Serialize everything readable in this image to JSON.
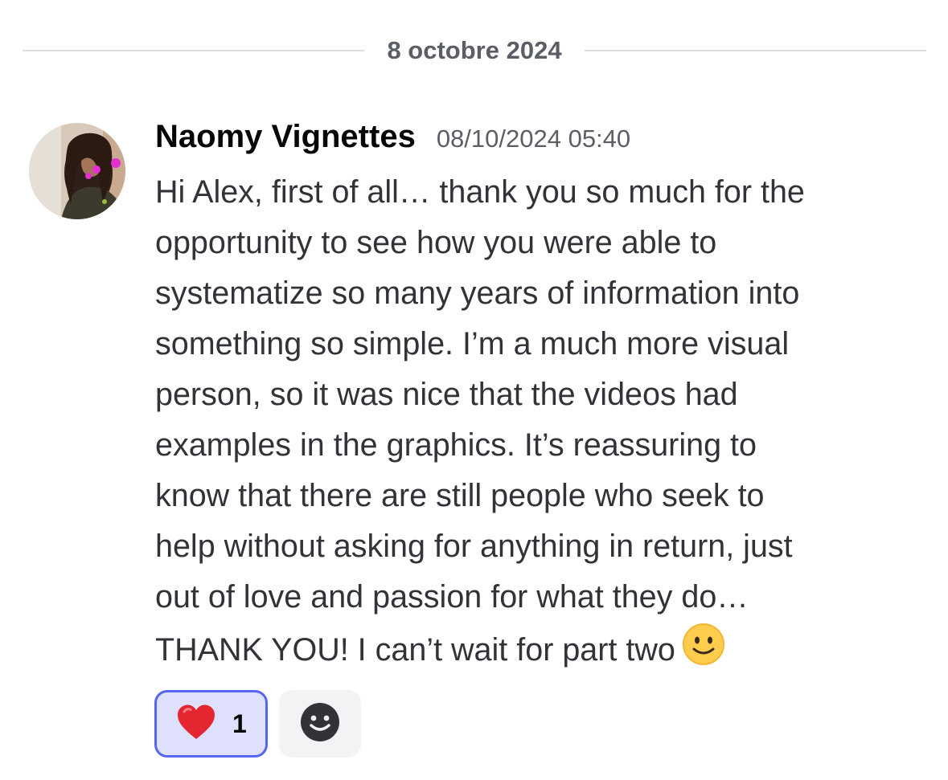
{
  "date_divider": {
    "label": "8 octobre 2024"
  },
  "message": {
    "author": "Naomy Vignettes",
    "timestamp": "08/10/2024 05:40",
    "lines": [
      "Hi Alex, first of all… thank you so much for the",
      "opportunity to see how you were able to",
      "systematize so many years of information into",
      "something so simple. I’m a much more visual",
      "person, so it was nice that the videos had",
      "examples in the graphics. It’s reassuring to",
      "know that there are still people who seek to",
      "help without asking for anything in return, just",
      "out of love and passion for what they do…",
      "THANK YOU! I can’t wait for part two"
    ],
    "trailing_emoji": "slightly-smiling-face-icon"
  },
  "reactions": [
    {
      "emoji": "red-heart-icon",
      "count": "1",
      "selected": true,
      "accent": "#5865f2",
      "background": "#dee0fc"
    }
  ],
  "add_reaction": {
    "icon": "add-reaction-smiley-icon"
  },
  "colors": {
    "username": "#060607",
    "body_text": "#313338",
    "muted_text": "#5c5e66",
    "divider": "#dcdde1",
    "heart": "#e3262f",
    "emoji_face": "#ffcc4d"
  }
}
